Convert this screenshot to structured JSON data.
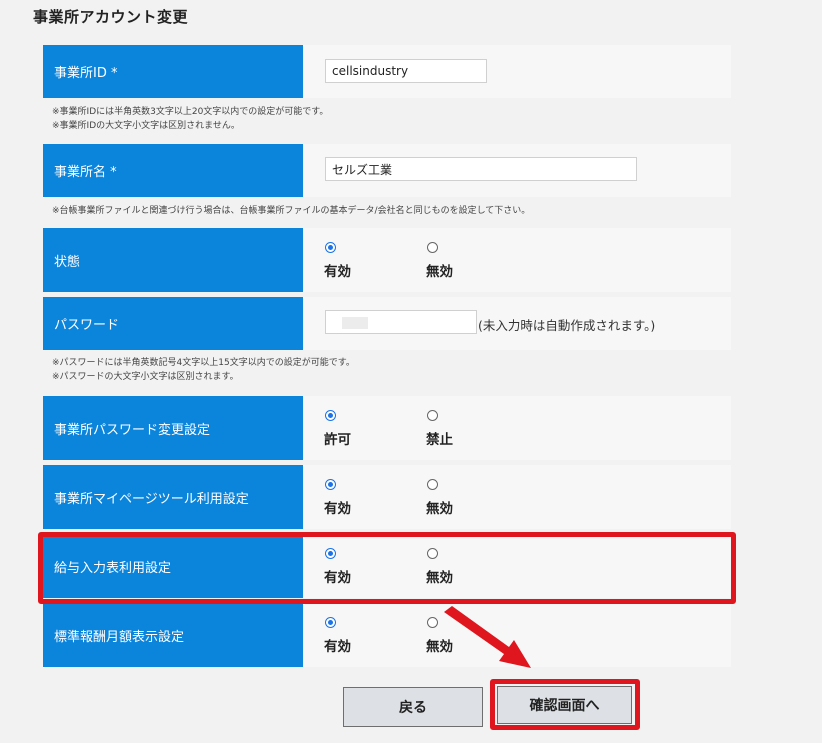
{
  "page": {
    "title": "事業所アカウント変更"
  },
  "fields": {
    "office_id": {
      "label": "事業所ID *",
      "value": "cellsindustry",
      "notes": [
        "※事業所IDには半角英数3文字以上20文字以内での設定が可能です。",
        "※事業所IDの大文字小文字は区別されません。"
      ]
    },
    "office_name": {
      "label": "事業所名 *",
      "value": "セルズ工業",
      "notes": [
        "※台帳事業所ファイルと関連づけ行う場合は、台帳事業所ファイルの基本データ/会社名と同じものを設定して下さい。"
      ]
    },
    "status": {
      "label": "状態",
      "options": [
        "有効",
        "無効"
      ],
      "selected": "有効"
    },
    "password": {
      "label": "パスワード",
      "value": "",
      "hint": "(未入力時は自動作成されます。)",
      "notes": [
        "※パスワードには半角英数記号4文字以上15文字以内での設定が可能です。",
        "※パスワードの大文字小文字は区別されます。"
      ]
    },
    "pw_change": {
      "label": "事業所パスワード変更設定",
      "options": [
        "許可",
        "禁止"
      ],
      "selected": "許可"
    },
    "mypage_tool": {
      "label": "事業所マイページツール利用設定",
      "options": [
        "有効",
        "無効"
      ],
      "selected": "有効"
    },
    "salary_input": {
      "label": "給与入力表利用設定",
      "options": [
        "有効",
        "無効"
      ],
      "selected": "有効"
    },
    "standard_remuneration": {
      "label": "標準報酬月額表示設定",
      "options": [
        "有効",
        "無効"
      ],
      "selected": "有効"
    }
  },
  "buttons": {
    "back": "戻る",
    "confirm": "確認画面へ"
  },
  "colors": {
    "label_bg": "#0b84dc",
    "highlight": "#e0161e",
    "radio_selected": "#1a73e8"
  }
}
